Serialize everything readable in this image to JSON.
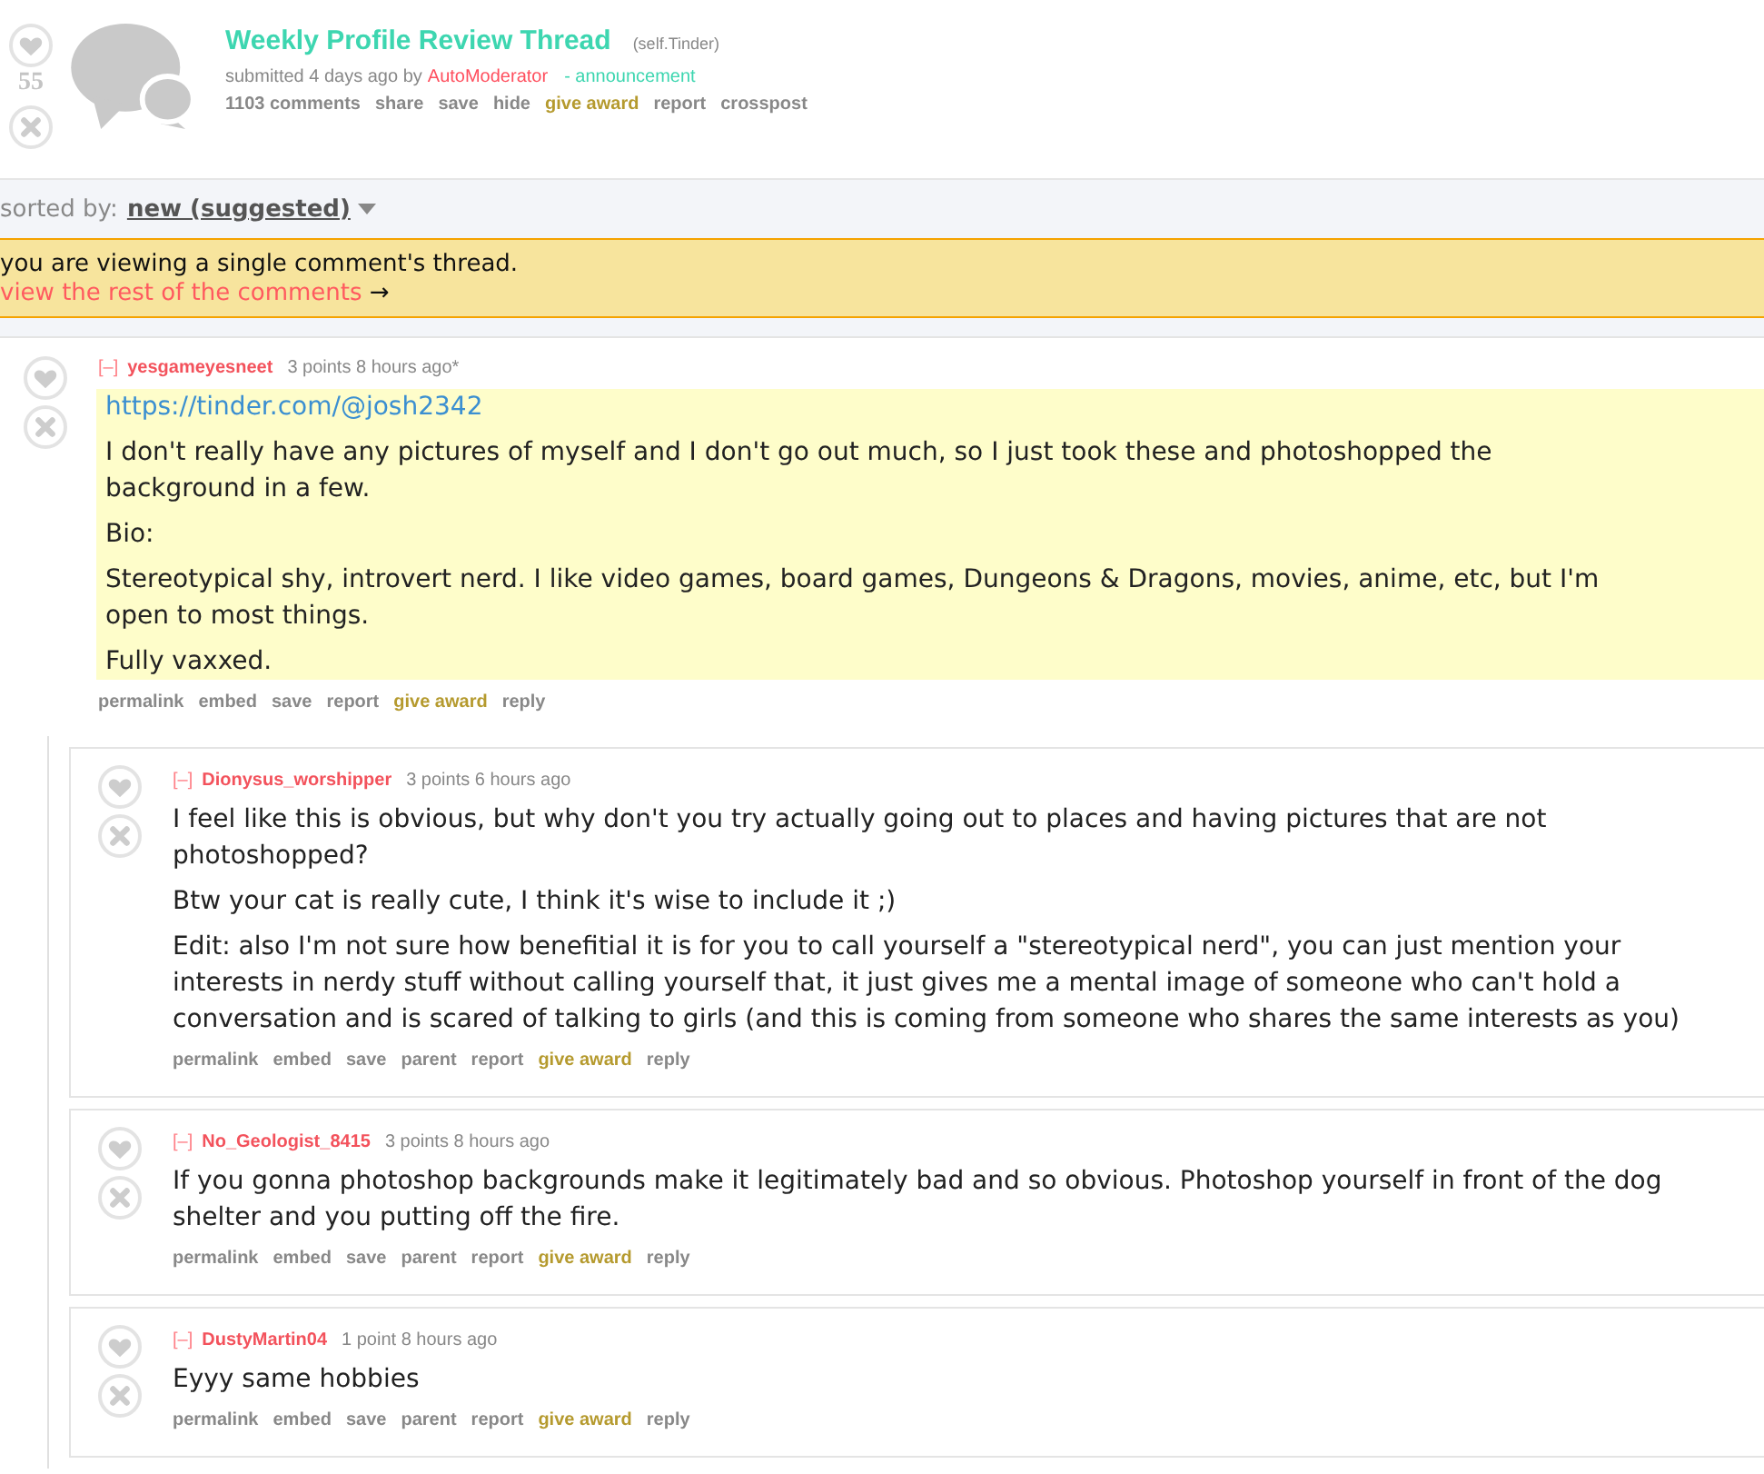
{
  "post": {
    "score": "55",
    "title": "Weekly Profile Review Thread",
    "domain": "(self.Tinder)",
    "submitted": "submitted 4 days ago by",
    "author": "AutoModerator",
    "flair": "- announcement",
    "actions": [
      {
        "label": "1103 comments",
        "kind": "link"
      },
      {
        "label": "share",
        "kind": "link"
      },
      {
        "label": "save",
        "kind": "link"
      },
      {
        "label": "hide",
        "kind": "link"
      },
      {
        "label": "give award",
        "kind": "award"
      },
      {
        "label": "report",
        "kind": "link"
      },
      {
        "label": "crosspost",
        "kind": "link"
      }
    ]
  },
  "sort": {
    "label": "sorted by:",
    "value": "new (suggested)"
  },
  "notice": {
    "text": "you are viewing a single comment's thread.",
    "link": "view the rest of the comments",
    "arrow": "→"
  },
  "comments": [
    {
      "collapse": "[–]",
      "author": "yesgameyesneet",
      "meta": "3 points 8 hours ago*",
      "highlighted": true,
      "body": [
        {
          "kind": "link",
          "text": "https://tinder.com/@josh2342"
        },
        {
          "kind": "text",
          "text": "I don't really have any pictures of myself and I don't go out much, so I just took these and photoshopped the background in a few."
        },
        {
          "kind": "text",
          "text": "Bio:"
        },
        {
          "kind": "text",
          "text": "Stereotypical shy, introvert nerd. I like video games, board games, Dungeons & Dragons, movies, anime, etc, but I'm open to most things."
        },
        {
          "kind": "text",
          "text": "Fully vaxxed."
        }
      ],
      "actions": [
        {
          "label": "permalink",
          "kind": "link"
        },
        {
          "label": "embed",
          "kind": "link"
        },
        {
          "label": "save",
          "kind": "link"
        },
        {
          "label": "report",
          "kind": "link"
        },
        {
          "label": "give award",
          "kind": "award"
        },
        {
          "label": "reply",
          "kind": "link"
        }
      ],
      "children": [
        {
          "collapse": "[–]",
          "author": "Dionysus_worshipper",
          "meta": "3 points 6 hours ago",
          "highlighted": false,
          "body": [
            {
              "kind": "text",
              "text": "I feel like this is obvious, but why don't you try actually going out to places and having pictures that are not photoshopped?"
            },
            {
              "kind": "text",
              "text": "Btw your cat is really cute, I think it's wise to include it ;)"
            },
            {
              "kind": "text",
              "text": "Edit: also I'm not sure how benefitial it is for you to call yourself a \"stereotypical nerd\", you can just mention your interests in nerdy stuff without calling yourself that, it just gives me a mental image of someone who can't hold a conversation and is scared of talking to girls (and this is coming from someone who shares the same interests as you)"
            }
          ],
          "actions": [
            {
              "label": "permalink",
              "kind": "link"
            },
            {
              "label": "embed",
              "kind": "link"
            },
            {
              "label": "save",
              "kind": "link"
            },
            {
              "label": "parent",
              "kind": "link"
            },
            {
              "label": "report",
              "kind": "link"
            },
            {
              "label": "give award",
              "kind": "award"
            },
            {
              "label": "reply",
              "kind": "link"
            }
          ]
        },
        {
          "collapse": "[–]",
          "author": "No_Geologist_8415",
          "meta": "3 points 8 hours ago",
          "highlighted": false,
          "body": [
            {
              "kind": "text",
              "text": "If you gonna photoshop backgrounds make it legitimately bad and so obvious. Photoshop yourself in front of the dog shelter and you putting off the fire."
            }
          ],
          "actions": [
            {
              "label": "permalink",
              "kind": "link"
            },
            {
              "label": "embed",
              "kind": "link"
            },
            {
              "label": "save",
              "kind": "link"
            },
            {
              "label": "parent",
              "kind": "link"
            },
            {
              "label": "report",
              "kind": "link"
            },
            {
              "label": "give award",
              "kind": "award"
            },
            {
              "label": "reply",
              "kind": "link"
            }
          ]
        },
        {
          "collapse": "[–]",
          "author": "DustyMartin04",
          "meta": "1 point 8 hours ago",
          "highlighted": false,
          "body": [
            {
              "kind": "text",
              "text": "Eyyy same hobbies"
            }
          ],
          "actions": [
            {
              "label": "permalink",
              "kind": "link"
            },
            {
              "label": "embed",
              "kind": "link"
            },
            {
              "label": "save",
              "kind": "link"
            },
            {
              "label": "parent",
              "kind": "link"
            },
            {
              "label": "report",
              "kind": "link"
            },
            {
              "label": "give award",
              "kind": "award"
            },
            {
              "label": "reply",
              "kind": "link"
            }
          ]
        }
      ]
    }
  ]
}
